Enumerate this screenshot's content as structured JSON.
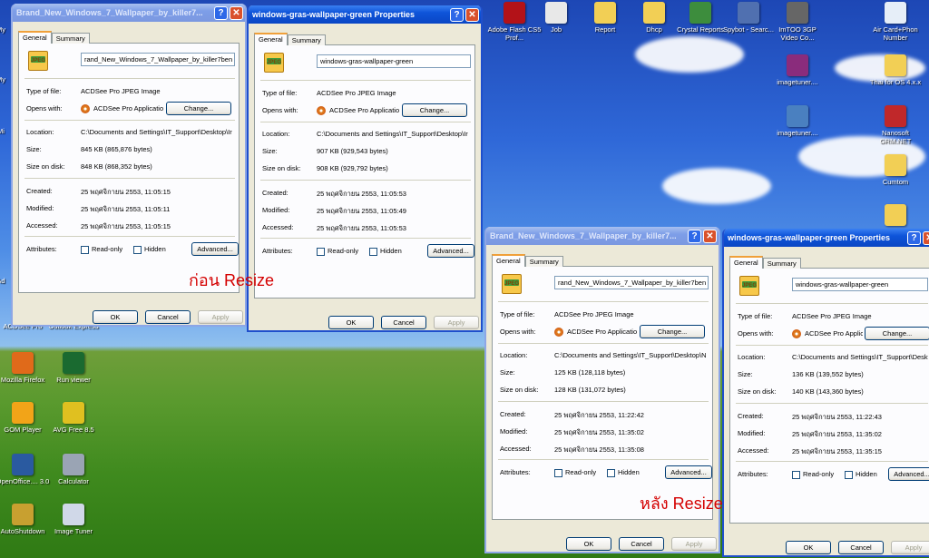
{
  "desktop_icons": [
    {
      "label": "Adobe Flash CS5 Prof...",
      "icon": "flash-icon",
      "color": "#b31218"
    },
    {
      "label": "Job",
      "icon": "pdf-icon",
      "color": "#e8e8e8"
    },
    {
      "label": "Report",
      "icon": "folder-icon",
      "color": "#f2cf55"
    },
    {
      "label": "Dhcp",
      "icon": "folder-icon",
      "color": "#f2cf55"
    },
    {
      "label": "Crystal Reports",
      "icon": "crystal-reports-icon",
      "color": "#3d8d3d"
    },
    {
      "label": "Spybot - Searc...",
      "icon": "spybot-icon",
      "color": "#5070b0"
    },
    {
      "label": "ImTOO 3GP Video Co...",
      "icon": "imtoo-icon",
      "color": "#666666"
    },
    {
      "label": "Air Card+Phon Number",
      "icon": "word-doc-icon",
      "color": "#e6eef8"
    },
    {
      "label": "imagetuner....",
      "icon": "winrar-icon",
      "color": "#8a2c7c"
    },
    {
      "label": "Thai for OS 4.x.x",
      "icon": "folder-icon",
      "color": "#f2cf55"
    },
    {
      "label": "imagetuner....",
      "icon": "installer-icon",
      "color": "#4a80c0"
    },
    {
      "label": "Nanosoft GRM.NET",
      "icon": "nanosoft-icon",
      "color": "#c0282a"
    },
    {
      "label": "Cumtom",
      "icon": "folder-icon",
      "color": "#f2cf55"
    },
    {
      "label": "",
      "icon": "folder-icon",
      "color": "#f2cf55"
    },
    {
      "label": "Mozilla Firefox",
      "icon": "firefox-icon",
      "color": "#e06a1a"
    },
    {
      "label": "Run viewer",
      "icon": "eye-icon",
      "color": "#1a6a30"
    },
    {
      "label": "GOM Player",
      "icon": "gom-player-icon",
      "color": "#f2a418"
    },
    {
      "label": "AVG Free 8.5",
      "icon": "avg-icon",
      "color": "#e0c020"
    },
    {
      "label": "OpenOffice.... 3.0",
      "icon": "openoffice-icon",
      "color": "#2a5aa0"
    },
    {
      "label": "Calculator",
      "icon": "calculator-icon",
      "color": "#9aa4b4"
    },
    {
      "label": "AutoShutdown",
      "icon": "autoshutdown-icon",
      "color": "#c8a030"
    },
    {
      "label": "Image Tuner",
      "icon": "image-tuner-icon",
      "color": "#d0d8e8"
    },
    {
      "label": "ACDSee Pro",
      "icon": "",
      "color": ""
    },
    {
      "label": "Outlook Express",
      "icon": "",
      "color": ""
    }
  ],
  "left_edge_fragments": [
    "My",
    "My",
    "Mi",
    "Ad"
  ],
  "common": {
    "tab_general": "General",
    "tab_summary": "Summary",
    "l_type": "Type of file:",
    "l_opens": "Opens with:",
    "l_location": "Location:",
    "l_size": "Size:",
    "l_disk": "Size on disk:",
    "l_created": "Created:",
    "l_modified": "Modified:",
    "l_accessed": "Accessed:",
    "l_attributes": "Attributes:",
    "readonly": "Read-only",
    "hidden": "Hidden",
    "advanced": "Advanced...",
    "change": "Change...",
    "ok": "OK",
    "cancel": "Cancel",
    "apply": "Apply",
    "type_val": "ACDSee Pro JPEG Image",
    "opens_val": "ACDSee Pro Applicatio",
    "help_glyph": "?",
    "close_glyph": "✕",
    "jpeg_tag": "JPEG"
  },
  "windows": [
    {
      "title": "Brand_New_Windows_7_Wallpaper_by_killer7...",
      "filename": "rand_New_Windows_7_Wallpaper_by_killer7ben",
      "location": "C:\\Documents and Settings\\IT_Support\\Desktop\\Ir",
      "size": "845 KB (865,876 bytes)",
      "disk": "848 KB (868,352 bytes)",
      "created": "25 พฤศจิกายน 2553, 11:05:15",
      "modified": "25 พฤศจิกายน 2553, 11:05:11",
      "accessed": "25 พฤศจิกายน 2553, 11:05:15"
    },
    {
      "title": "windows-gras-wallpaper-green Properties",
      "filename": "windows-gras-wallpaper-green",
      "location": "C:\\Documents and Settings\\IT_Support\\Desktop\\Ir",
      "size": "907 KB (929,543 bytes)",
      "disk": "908 KB (929,792 bytes)",
      "created": "25 พฤศจิกายน 2553, 11:05:53",
      "modified": "25 พฤศจิกายน 2553, 11:05:49",
      "accessed": "25 พฤศจิกายน 2553, 11:05:53"
    },
    {
      "title": "Brand_New_Windows_7_Wallpaper_by_killer7...",
      "filename": "rand_New_Windows_7_Wallpaper_by_killer7ben",
      "location": "C:\\Documents and Settings\\IT_Support\\Desktop\\N",
      "size": "125 KB (128,118 bytes)",
      "disk": "128 KB (131,072 bytes)",
      "created": "25 พฤศจิกายน 2553, 11:22:42",
      "modified": "25 พฤศจิกายน 2553, 11:35:02",
      "accessed": "25 พฤศจิกายน 2553, 11:35:08"
    },
    {
      "title": "windows-gras-wallpaper-green Properties",
      "filename": "windows-gras-wallpaper-green",
      "location": "C:\\Documents and Settings\\IT_Support\\Desktop\\N",
      "size": "136 KB (139,552 bytes)",
      "disk": "140 KB (143,360 bytes)",
      "created": "25 พฤศจิกายน 2553, 11:22:43",
      "modified": "25 พฤศจิกายน 2553, 11:35:02",
      "accessed": "25 พฤศจิกายน 2553, 11:35:15"
    }
  ],
  "captions": {
    "before": "ก่อน Resize",
    "after": "หลัง Resize"
  },
  "colors": {
    "caption": "#d40000",
    "titlebar_active": "#0a46c4",
    "dialog_bg": "#ece9d8"
  }
}
